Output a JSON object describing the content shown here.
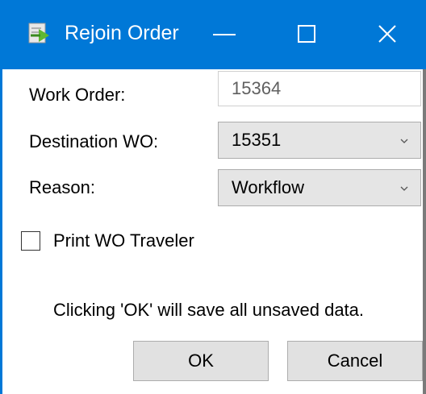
{
  "window": {
    "title": "Rejoin Order",
    "accent_color": "#0078d7",
    "icon": "rejoin-order-app-icon",
    "controls": {
      "minimize": "minimize-icon",
      "maximize": "maximize-icon",
      "close": "close-icon"
    }
  },
  "form": {
    "work_order": {
      "label": "Work Order:",
      "value": "15364"
    },
    "destination_wo": {
      "label": "Destination WO:",
      "selected": "15351"
    },
    "reason": {
      "label": "Reason:",
      "selected": "Workflow"
    },
    "print_traveler": {
      "label": "Print WO Traveler",
      "checked": false
    }
  },
  "info_text": "Clicking 'OK' will save all unsaved data.",
  "buttons": {
    "ok": "OK",
    "cancel": "Cancel"
  }
}
